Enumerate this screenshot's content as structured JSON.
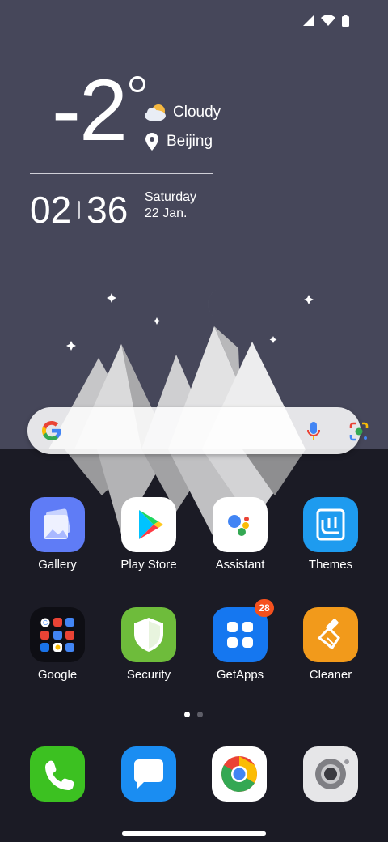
{
  "weather": {
    "temperature": "-2",
    "condition": "Cloudy",
    "location": "Beijing"
  },
  "clock": {
    "hours": "02",
    "minutes": "36",
    "day": "Saturday",
    "date": "22 Jan."
  },
  "status_icons": [
    "signal-icon",
    "wifi-icon",
    "battery-icon"
  ],
  "search": {
    "icons": [
      "google-g-icon",
      "mic-icon",
      "lens-icon"
    ]
  },
  "apps": [
    {
      "label": "Gallery",
      "icon": "gallery-icon",
      "color": "#5f7cf6"
    },
    {
      "label": "Play Store",
      "icon": "play-store-icon",
      "color": "#ffffff"
    },
    {
      "label": "Assistant",
      "icon": "assistant-icon",
      "color": "#ffffff"
    },
    {
      "label": "Themes",
      "icon": "themes-icon",
      "color": "#1e9bef"
    },
    {
      "label": "Google",
      "icon": "google-folder-icon",
      "color": "#0e0e14"
    },
    {
      "label": "Security",
      "icon": "security-shield-icon",
      "color": "#6ebc3b"
    },
    {
      "label": "GetApps",
      "icon": "getapps-icon",
      "color": "#1577f0",
      "badge": "28"
    },
    {
      "label": "Cleaner",
      "icon": "cleaner-icon",
      "color": "#f29a1b"
    }
  ],
  "dock": [
    {
      "icon": "phone-icon",
      "color": "#3cc121"
    },
    {
      "icon": "messages-icon",
      "color": "#1a8df2"
    },
    {
      "icon": "chrome-icon",
      "color": "#ffffff"
    },
    {
      "icon": "camera-icon",
      "color": "#e6e6e8"
    }
  ],
  "page_indicator": {
    "pages": 2,
    "current": 1
  }
}
